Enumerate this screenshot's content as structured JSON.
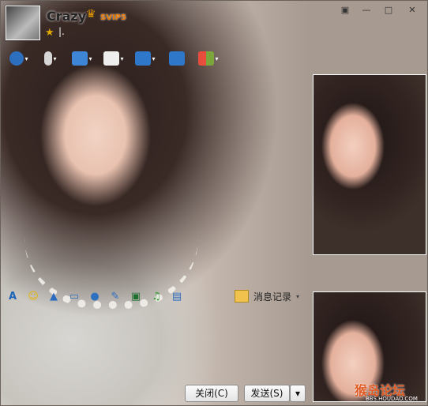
{
  "profile": {
    "name": "Crazy",
    "vip_badge": "SVIP5",
    "status_text": "|."
  },
  "window_controls": [
    "▣",
    "—",
    "□",
    "✕"
  ],
  "top_toolbar": [
    {
      "icon": "video-call-icon",
      "color": "#2d6fbf"
    },
    {
      "icon": "microphone-icon",
      "color": "#d7d7d7"
    },
    {
      "icon": "file-transfer-icon",
      "color": "#3e86d5"
    },
    {
      "icon": "add-chat-icon",
      "color": "#eeeeee"
    },
    {
      "icon": "remote-desktop-icon",
      "color": "#2f77c8"
    },
    {
      "icon": "screen-share-icon",
      "color": "#2f77c8"
    },
    {
      "icon": "apps-grid-icon",
      "color": "#7aa63c"
    }
  ],
  "input_toolbar": [
    {
      "icon": "font-icon",
      "glyph": "A",
      "color": "#1f63b5"
    },
    {
      "icon": "emoji-icon",
      "glyph": "☺",
      "color": "#e5b400"
    },
    {
      "icon": "shake-icon",
      "glyph": "▲",
      "color": "#2c6cc0"
    },
    {
      "icon": "video-clip-icon",
      "glyph": "▭",
      "color": "#2f6fbf"
    },
    {
      "icon": "voice-message-icon",
      "glyph": "●",
      "color": "#2f6fbf"
    },
    {
      "icon": "note-icon",
      "glyph": "✎",
      "color": "#2f6fbf"
    },
    {
      "icon": "image-icon",
      "glyph": "▣",
      "color": "#1e6e2e"
    },
    {
      "icon": "music-icon",
      "glyph": "♫",
      "color": "#3a9c3a"
    },
    {
      "icon": "screenshot-icon",
      "glyph": "▤",
      "color": "#2f6fbf"
    }
  ],
  "history": {
    "label": "消息记录"
  },
  "buttons": {
    "close": "关闭(C)",
    "send": "发送(S)",
    "send_options": "▾"
  },
  "watermark": {
    "text": "猴岛论坛",
    "url": "BBS.HOUDAO.COM"
  }
}
